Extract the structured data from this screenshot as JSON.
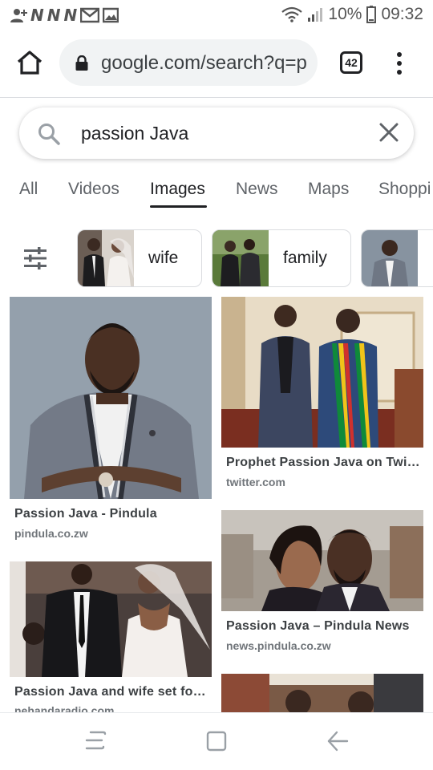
{
  "status_bar": {
    "n_icons": [
      "N",
      "N",
      "N"
    ],
    "battery": "10%",
    "time": "09:32"
  },
  "browser": {
    "url": "google.com/search?q=p",
    "tab_count": "42"
  },
  "search": {
    "query": "passion Java"
  },
  "tabs": [
    {
      "label": "All"
    },
    {
      "label": "Videos"
    },
    {
      "label": "Images"
    },
    {
      "label": "News"
    },
    {
      "label": "Maps"
    },
    {
      "label": "Shoppi"
    }
  ],
  "active_tab": "Images",
  "chips": [
    {
      "label": "wife"
    },
    {
      "label": "family"
    }
  ],
  "results": [
    {
      "title": "Passion Java - Pindula",
      "domain": "pindula.co.zw"
    },
    {
      "title": "Prophet Passion Java on Twit…",
      "domain": "twitter.com"
    },
    {
      "title": "Passion Java – Pindula News",
      "domain": "news.pindula.co.zw"
    },
    {
      "title": "Passion Java and wife set for…",
      "domain": "nehandaradio.com"
    }
  ],
  "colors": {
    "accent": "#1a73e8",
    "text_primary": "#202124",
    "text_secondary": "#5f6368",
    "pill_bg": "#f1f3f4"
  }
}
